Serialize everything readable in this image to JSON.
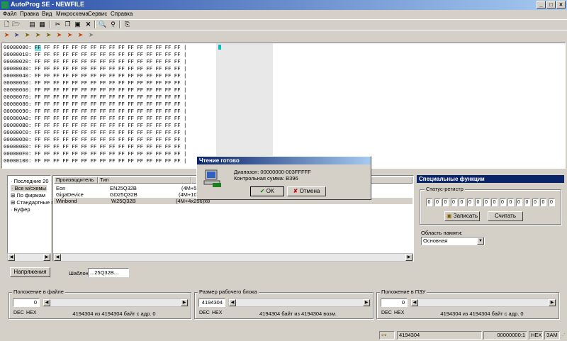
{
  "window": {
    "title": "AutoProg SE - NEWFILE"
  },
  "menu": [
    "Файл",
    "Правка",
    "Вид",
    "Микросхема",
    "Сервис",
    "Справка"
  ],
  "hex": {
    "addresses": [
      "00000000:",
      "00000010:",
      "00000020:",
      "00000030:",
      "00000040:",
      "00000050:",
      "00000060:",
      "00000070:",
      "00000080:",
      "00000090:",
      "000000A0:",
      "000000B0:",
      "000000C0:",
      "000000D0:",
      "000000E0:",
      "000000F0:",
      "00000100:"
    ],
    "first_byte": "FF",
    "row_bytes": "FF FF FF FF FF FF FF FF FF FF FF FF FF FF FF",
    "separator": "|"
  },
  "tree": [
    "Последние 20",
    "Все м/схемы",
    "По фирмам",
    "Стандартные г",
    "Буфер"
  ],
  "list": {
    "headers": [
      "Производитель",
      "Тип",
      "О"
    ],
    "rows": [
      {
        "maker": "Eon",
        "type": "EN25Q32B",
        "org": "(4M+5"
      },
      {
        "maker": "GigaDevice",
        "type": "GD25Q32B",
        "org": "(4M+10"
      },
      {
        "maker": "Winbond",
        "type": "W25Q32B",
        "org": "(4M+4x256)x8"
      }
    ]
  },
  "buttons": {
    "voltage": "Напряжения",
    "template_label": "Шаблон",
    "template_value": "...25Q32B..."
  },
  "dialog": {
    "title": "Чтение готово",
    "range": "Диапазон: 00000000-003FFFFF",
    "checksum": "Контрольная сумма: B396",
    "ok": "OK",
    "cancel": "Отмена",
    "ok_mark": "✔",
    "cancel_mark": "✘"
  },
  "special": {
    "title": "Специальные функции",
    "status_register_label": "Статус-регистр",
    "bits": [
      "0",
      "0",
      "0",
      "0",
      "0",
      "0",
      "0",
      "0",
      "0",
      "0",
      "0",
      "0",
      "0",
      "0",
      "0",
      "0"
    ],
    "write": "Записать",
    "read": "Считать",
    "memory_area_label": "Область памяти:",
    "memory_area_value": "Основная"
  },
  "panels": [
    {
      "title": "Положение в файле",
      "value": "0",
      "status": "4194304 из 4194304 байт с адр. 0"
    },
    {
      "title": "Размер рабочего блока",
      "value": "4194304",
      "status": "4194304 байт из 4194304 возм."
    },
    {
      "title": "Положение в ПЗУ",
      "value": "0",
      "status": "4194304 из 4194304 байт с адр. 0"
    }
  ],
  "dec_hex": [
    "DEC",
    "HEX"
  ],
  "statusbar": {
    "size": "4194304",
    "pos": "00000000:1",
    "mode": "HEX",
    "ins": "ЗАМ"
  },
  "colors": {
    "title_start": "#2a4fa8",
    "dialog_title": "#0a246a",
    "cursor": "#00c0c0"
  },
  "icons": [
    "app-icon",
    "new-file-icon",
    "open-icon",
    "save-icon",
    "cut-icon",
    "copy-icon",
    "paste-icon",
    "delete-icon",
    "find-icon",
    "device-icon",
    "read-chip-icon",
    "write-chip-icon",
    "erase-icon",
    "verify-icon",
    "blank-check-icon",
    "chip-computer-icon",
    "check-icon",
    "cross-icon"
  ]
}
